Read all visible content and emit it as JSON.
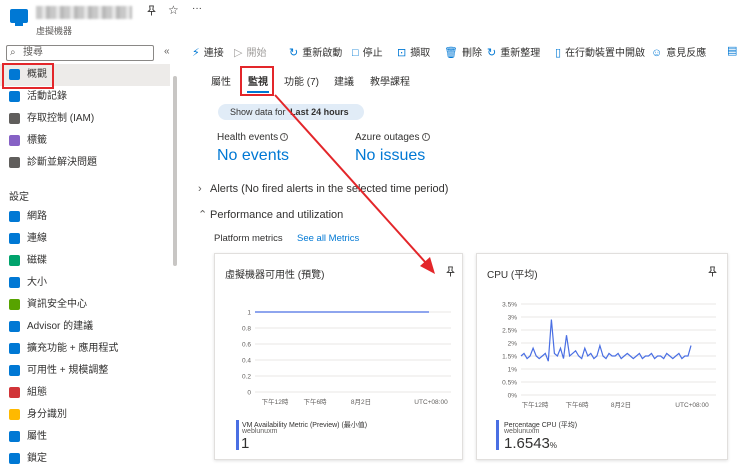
{
  "header": {
    "subtitle": "虛擬機器",
    "pin_icon": "pin-icon",
    "star_icon": "star-icon",
    "more_label": "···"
  },
  "sidebar": {
    "search_placeholder": "搜尋",
    "collapse_label": "«",
    "items": [
      {
        "label": "概觀",
        "icon": "overview-icon",
        "color": "#0078d4",
        "selected": true
      },
      {
        "label": "活動記錄",
        "icon": "activity-log-icon",
        "color": "#0078d4"
      },
      {
        "label": "存取控制 (IAM)",
        "icon": "people-icon",
        "color": "#605e5c"
      },
      {
        "label": "標籤",
        "icon": "tag-icon",
        "color": "#8661c5"
      },
      {
        "label": "診斷並解決問題",
        "icon": "wrench-icon",
        "color": "#605e5c"
      }
    ],
    "settings_label": "設定",
    "settings_items": [
      {
        "label": "網路",
        "icon": "network-icon",
        "color": "#0078d4"
      },
      {
        "label": "連線",
        "icon": "connect-icon",
        "color": "#0078d4"
      },
      {
        "label": "磁碟",
        "icon": "disk-icon",
        "color": "#00a36c"
      },
      {
        "label": "大小",
        "icon": "size-icon",
        "color": "#0078d4"
      },
      {
        "label": "資訊安全中心",
        "icon": "shield-icon",
        "color": "#57a300"
      },
      {
        "label": "Advisor 的建議",
        "icon": "advisor-icon",
        "color": "#0078d4"
      },
      {
        "label": "擴充功能 + 應用程式",
        "icon": "extensions-icon",
        "color": "#0078d4"
      },
      {
        "label": "可用性 + 規模調整",
        "icon": "availability-icon",
        "color": "#0078d4"
      },
      {
        "label": "組態",
        "icon": "configuration-icon",
        "color": "#d13438"
      },
      {
        "label": "身分識別",
        "icon": "identity-icon",
        "color": "#ffb900"
      },
      {
        "label": "屬性",
        "icon": "properties-icon",
        "color": "#0078d4"
      },
      {
        "label": "鎖定",
        "icon": "lock-icon",
        "color": "#0078d4"
      }
    ]
  },
  "toolbar": {
    "items": [
      {
        "label": "連接",
        "icon": "plug-icon",
        "disabled": false
      },
      {
        "label": "開始",
        "icon": "play-icon",
        "disabled": true
      },
      {
        "label": "重新啟動",
        "icon": "restart-icon",
        "disabled": false
      },
      {
        "label": "停止",
        "icon": "stop-icon",
        "disabled": false
      },
      {
        "label": "擷取",
        "icon": "capture-icon",
        "disabled": false
      },
      {
        "label": "刪除",
        "icon": "trash-icon",
        "disabled": false
      },
      {
        "label": "重新整理",
        "icon": "refresh-icon",
        "disabled": false
      },
      {
        "label": "在行動裝置中開啟",
        "icon": "mobile-icon",
        "disabled": false
      },
      {
        "label": "意見反應",
        "icon": "feedback-icon",
        "disabled": false
      },
      {
        "label": "CL",
        "icon": "cli-icon",
        "disabled": false
      }
    ]
  },
  "tabs": [
    {
      "label": "屬性"
    },
    {
      "label": "監視",
      "active": true
    },
    {
      "label": "功能 (7)"
    },
    {
      "label": "建議"
    },
    {
      "label": "教學課程"
    }
  ],
  "time_pill": {
    "prefix": "Show data for",
    "value": "Last 24 hours"
  },
  "health": {
    "label": "Health events",
    "value": "No events"
  },
  "outages": {
    "label": "Azure outages",
    "value": "No issues"
  },
  "alerts_section": "Alerts (No fired alerts in the selected time period)",
  "performance_section": "Performance and utilization",
  "platform_metrics": "Platform metrics",
  "see_all": "See all Metrics",
  "annotation_color": "#e3262a",
  "chart_data": [
    {
      "type": "line",
      "title": "虛擬機器可用性 (預覽)",
      "y_ticks": [
        "1",
        "0.8",
        "0.6",
        "0.4",
        "0.2",
        "0"
      ],
      "x_ticks": [
        "下午12時",
        "下午6時",
        "8月2日",
        "UTC+08:00"
      ],
      "ylim": [
        0,
        1
      ],
      "series": [
        {
          "name": "VM Availability Metric (Preview) (最小值)",
          "sub": "weblunuxm",
          "values": [
            1,
            1,
            1,
            1,
            1,
            1,
            1,
            1,
            1,
            1,
            1,
            1,
            1,
            1,
            1,
            1,
            1,
            1,
            1,
            1
          ],
          "summary": "1",
          "unit": ""
        }
      ]
    },
    {
      "type": "line",
      "title": "CPU (平均)",
      "y_ticks": [
        "3.5%",
        "3%",
        "2.5%",
        "2%",
        "1.5%",
        "1%",
        "0.5%",
        "0%"
      ],
      "x_ticks": [
        "下午12時",
        "下午6時",
        "8月2日",
        "UTC+08:00"
      ],
      "ylim": [
        0,
        3.5
      ],
      "series": [
        {
          "name": "Percentage CPU (平均)",
          "sub": "weblunuxm",
          "values": [
            1.5,
            1.6,
            1.4,
            1.5,
            1.8,
            1.5,
            1.4,
            1.5,
            1.6,
            1.3,
            2.9,
            1.6,
            1.5,
            1.8,
            1.4,
            2.3,
            1.5,
            1.6,
            1.7,
            1.5,
            1.4,
            1.8,
            1.5,
            1.6,
            1.4,
            1.5,
            1.9,
            1.5,
            1.4,
            1.6,
            1.5,
            1.5,
            1.6,
            1.4,
            1.5,
            1.6,
            1.5,
            1.4,
            1.5,
            1.6,
            1.4,
            1.5,
            1.5,
            1.6,
            1.4,
            1.5,
            1.5,
            1.4,
            1.6,
            1.5,
            1.4,
            1.5,
            1.6,
            1.4,
            1.5,
            1.5,
            1.9
          ],
          "summary": "1.6543",
          "unit": "%"
        }
      ]
    }
  ]
}
